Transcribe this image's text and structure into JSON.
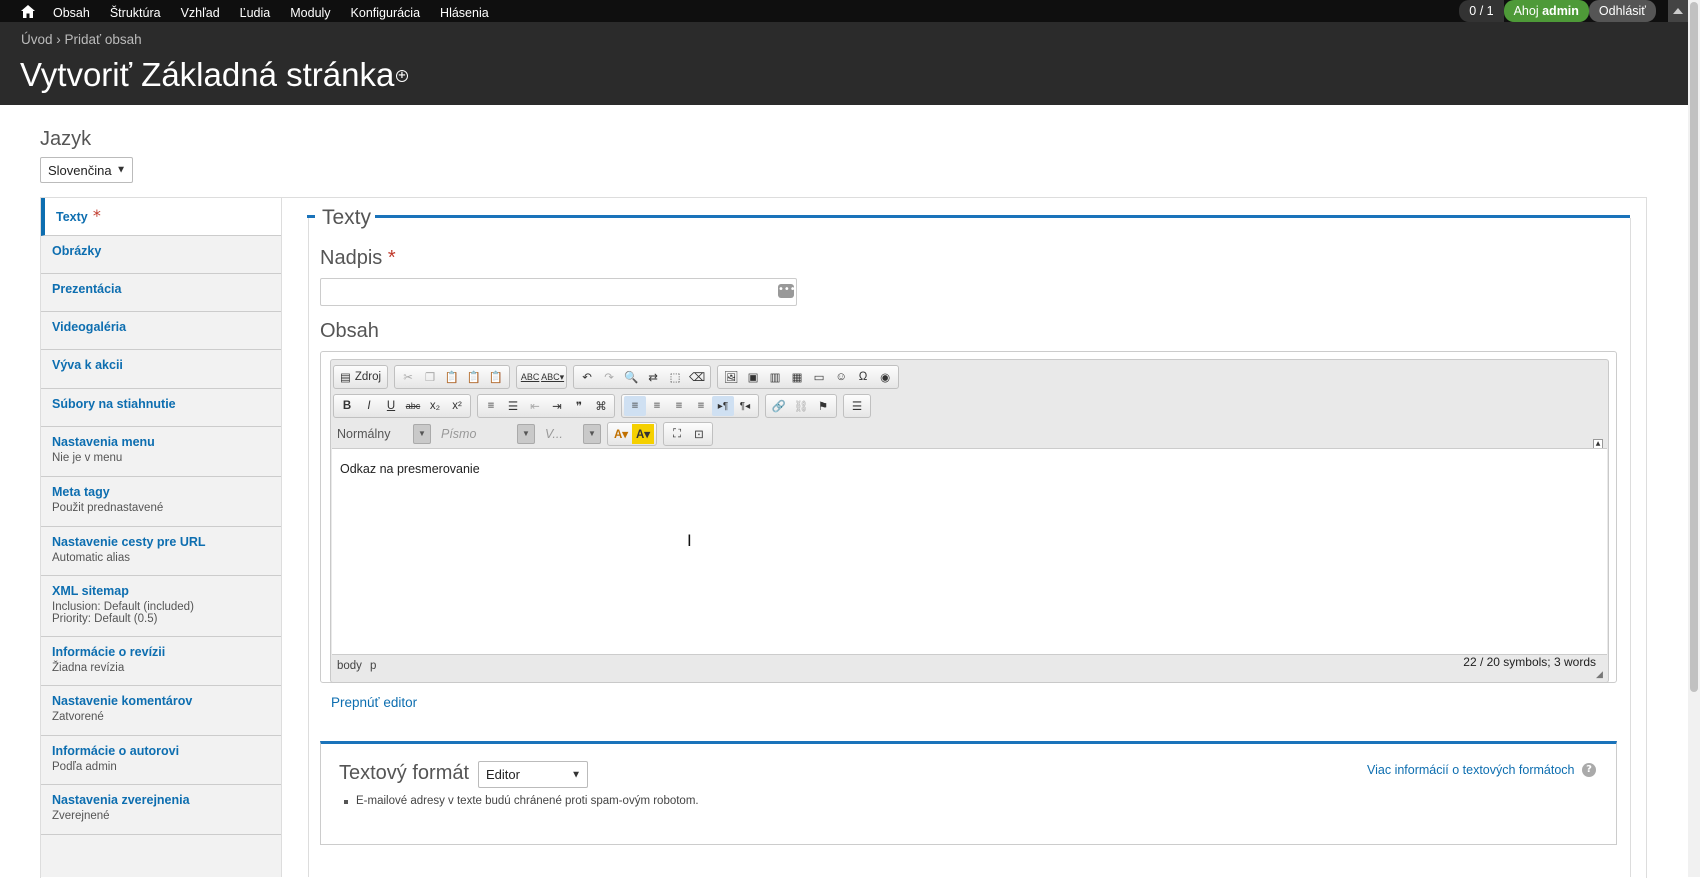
{
  "toolbar": {
    "menu": [
      "Obsah",
      "Štruktúra",
      "Vzhľad",
      "Ľudia",
      "Moduly",
      "Konfigurácia",
      "Hlásenia"
    ],
    "count": "0 / 1",
    "greeting_prefix": "Ahoj ",
    "greeting_user": "admin",
    "logout": "Odhlásiť"
  },
  "header": {
    "breadcrumb": [
      "Úvod",
      "Pridať obsah"
    ],
    "breadcrumb_sep": "›",
    "title": "Vytvoriť Základná stránka"
  },
  "language": {
    "label": "Jazyk",
    "value": "Slovenčina"
  },
  "tabs": [
    {
      "title": "Texty",
      "required": "*",
      "summary": ""
    },
    {
      "title": "Obrázky",
      "summary": ""
    },
    {
      "title": "Prezentácia",
      "summary": ""
    },
    {
      "title": "Videogaléria",
      "summary": ""
    },
    {
      "title": "Výva k akcii",
      "summary": ""
    },
    {
      "title": "Súbory na stiahnutie",
      "summary": ""
    },
    {
      "title": "Nastavenia menu",
      "summary": "Nie je v menu"
    },
    {
      "title": "Meta tagy",
      "summary": "Použit prednastavené"
    },
    {
      "title": "Nastavenie cesty pre URL",
      "summary": "Automatic alias"
    },
    {
      "title": "XML sitemap",
      "summary": "Inclusion: Default (included)",
      "summary2": "Priority: Default (0.5)"
    },
    {
      "title": "Informácie o revízii",
      "summary": "Žiadna revízia"
    },
    {
      "title": "Nastavenie komentárov",
      "summary": "Zatvorené"
    },
    {
      "title": "Informácie o autorovi",
      "summary": "Podľa admin"
    },
    {
      "title": "Nastavenia zverejnenia",
      "summary": "Zverejnené"
    }
  ],
  "fieldset": {
    "legend": "Texty",
    "title_label": "Nadpis",
    "title_required": "*",
    "title_value": "",
    "body_label": "Obsah"
  },
  "editor": {
    "source_label": "Zdroj",
    "format_combo": "Normálny",
    "font_combo": "Písmo",
    "size_combo": "V...",
    "content": "Odkaz na presmerovanie",
    "path": [
      "body",
      "p"
    ],
    "wordcount": "22 / 20 symbols; 3 words",
    "switch_link": "Prepnúť editor"
  },
  "text_format": {
    "label": "Textový formát",
    "value": "Editor",
    "more_link": "Viac informácií o textových formátoch",
    "note": "E-mailové adresy v texte budú chránené proti spam-ovým robotom."
  }
}
